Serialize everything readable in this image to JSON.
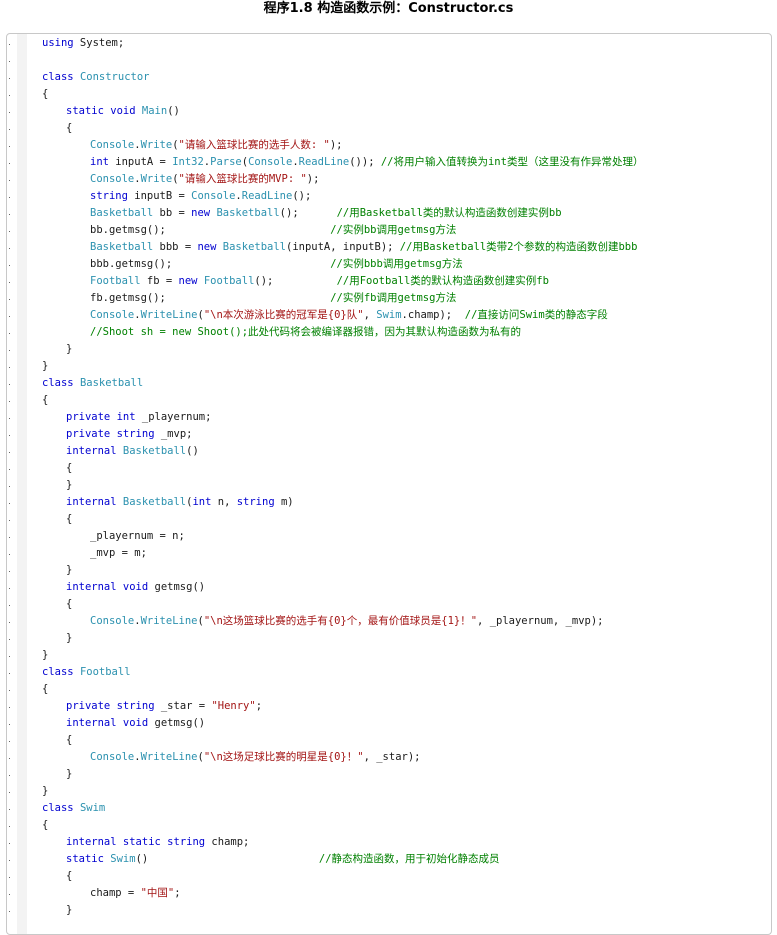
{
  "title": "程序1.8 构造函数示例：Constructor.cs",
  "colors": {
    "keyword": "#0000d0",
    "type": "#2b91af",
    "string": "#a31515",
    "comment": "#008000",
    "plain": "#1a1a1a"
  },
  "lines": [
    {
      "indent": 0,
      "tokens": [
        [
          "k",
          "using"
        ],
        [
          "p",
          " System;"
        ]
      ]
    },
    {
      "indent": 0,
      "tokens": []
    },
    {
      "indent": 0,
      "tokens": [
        [
          "k",
          "class"
        ],
        [
          "p",
          " "
        ],
        [
          "t",
          "Constructor"
        ]
      ]
    },
    {
      "indent": 0,
      "tokens": [
        [
          "p",
          "{"
        ]
      ]
    },
    {
      "indent": 1,
      "tokens": [
        [
          "k",
          "static"
        ],
        [
          "p",
          " "
        ],
        [
          "k",
          "void"
        ],
        [
          "p",
          " "
        ],
        [
          "t",
          "Main"
        ],
        [
          "p",
          "()"
        ]
      ]
    },
    {
      "indent": 1,
      "tokens": [
        [
          "p",
          "{"
        ]
      ]
    },
    {
      "indent": 2,
      "tokens": [
        [
          "t",
          "Console"
        ],
        [
          "p",
          "."
        ],
        [
          "t",
          "Write"
        ],
        [
          "p",
          "("
        ],
        [
          "s",
          "\"请输入篮球比赛的选手人数: \""
        ],
        [
          "p",
          ");"
        ]
      ]
    },
    {
      "indent": 2,
      "tokens": [
        [
          "k",
          "int"
        ],
        [
          "p",
          " inputA = "
        ],
        [
          "t",
          "Int32"
        ],
        [
          "p",
          "."
        ],
        [
          "t",
          "Parse"
        ],
        [
          "p",
          "("
        ],
        [
          "t",
          "Console"
        ],
        [
          "p",
          "."
        ],
        [
          "t",
          "ReadLine"
        ],
        [
          "p",
          "()); "
        ],
        [
          "c",
          "//将用户输入值转换为int类型（这里没有作异常处理）"
        ]
      ]
    },
    {
      "indent": 2,
      "tokens": [
        [
          "t",
          "Console"
        ],
        [
          "p",
          "."
        ],
        [
          "t",
          "Write"
        ],
        [
          "p",
          "("
        ],
        [
          "s",
          "\"请输入篮球比赛的MVP: \""
        ],
        [
          "p",
          ");"
        ]
      ]
    },
    {
      "indent": 2,
      "tokens": [
        [
          "k",
          "string"
        ],
        [
          "p",
          " inputB = "
        ],
        [
          "t",
          "Console"
        ],
        [
          "p",
          "."
        ],
        [
          "t",
          "ReadLine"
        ],
        [
          "p",
          "();"
        ]
      ]
    },
    {
      "indent": 2,
      "tokens": [
        [
          "t",
          "Basketball"
        ],
        [
          "p",
          " bb = "
        ],
        [
          "k",
          "new"
        ],
        [
          "p",
          " "
        ],
        [
          "t",
          "Basketball"
        ],
        [
          "p",
          "();      "
        ],
        [
          "c",
          "//用Basketball类的默认构造函数创建实例bb"
        ]
      ]
    },
    {
      "indent": 2,
      "tokens": [
        [
          "p",
          "bb.getmsg();                          "
        ],
        [
          "c",
          "//实例bb调用getmsg方法"
        ]
      ]
    },
    {
      "indent": 2,
      "tokens": [
        [
          "t",
          "Basketball"
        ],
        [
          "p",
          " bbb = "
        ],
        [
          "k",
          "new"
        ],
        [
          "p",
          " "
        ],
        [
          "t",
          "Basketball"
        ],
        [
          "p",
          "(inputA, inputB); "
        ],
        [
          "c",
          "//用Basketball类带2个参数的构造函数创建bbb"
        ]
      ]
    },
    {
      "indent": 2,
      "tokens": [
        [
          "p",
          "bbb.getmsg();                         "
        ],
        [
          "c",
          "//实例bbb调用getmsg方法"
        ]
      ]
    },
    {
      "indent": 2,
      "tokens": [
        [
          "t",
          "Football"
        ],
        [
          "p",
          " fb = "
        ],
        [
          "k",
          "new"
        ],
        [
          "p",
          " "
        ],
        [
          "t",
          "Football"
        ],
        [
          "p",
          "();          "
        ],
        [
          "c",
          "//用Football类的默认构造函数创建实例fb"
        ]
      ]
    },
    {
      "indent": 2,
      "tokens": [
        [
          "p",
          "fb.getmsg();                          "
        ],
        [
          "c",
          "//实例fb调用getmsg方法"
        ]
      ]
    },
    {
      "indent": 2,
      "tokens": [
        [
          "t",
          "Console"
        ],
        [
          "p",
          "."
        ],
        [
          "t",
          "WriteLine"
        ],
        [
          "p",
          "("
        ],
        [
          "s",
          "\"\\n本次游泳比赛的冠军是{0}队\""
        ],
        [
          "p",
          ", "
        ],
        [
          "t",
          "Swim"
        ],
        [
          "p",
          ".champ);  "
        ],
        [
          "c",
          "//直接访问Swim类的静态字段"
        ]
      ]
    },
    {
      "indent": 2,
      "tokens": [
        [
          "c",
          "//Shoot sh = new Shoot();此处代码将会被编译器报错，因为其默认构造函数为私有的"
        ]
      ]
    },
    {
      "indent": 1,
      "tokens": [
        [
          "p",
          "}"
        ]
      ]
    },
    {
      "indent": 0,
      "tokens": [
        [
          "p",
          "}"
        ]
      ]
    },
    {
      "indent": 0,
      "tokens": [
        [
          "k",
          "class"
        ],
        [
          "p",
          " "
        ],
        [
          "t",
          "Basketball"
        ]
      ]
    },
    {
      "indent": 0,
      "tokens": [
        [
          "p",
          "{"
        ]
      ]
    },
    {
      "indent": 1,
      "tokens": [
        [
          "k",
          "private"
        ],
        [
          "p",
          " "
        ],
        [
          "k",
          "int"
        ],
        [
          "p",
          " _playernum;"
        ]
      ]
    },
    {
      "indent": 1,
      "tokens": [
        [
          "k",
          "private"
        ],
        [
          "p",
          " "
        ],
        [
          "k",
          "string"
        ],
        [
          "p",
          " _mvp;"
        ]
      ]
    },
    {
      "indent": 1,
      "tokens": [
        [
          "k",
          "internal"
        ],
        [
          "p",
          " "
        ],
        [
          "t",
          "Basketball"
        ],
        [
          "p",
          "()"
        ]
      ]
    },
    {
      "indent": 1,
      "tokens": [
        [
          "p",
          "{"
        ]
      ]
    },
    {
      "indent": 1,
      "tokens": [
        [
          "p",
          "}"
        ]
      ]
    },
    {
      "indent": 1,
      "tokens": [
        [
          "k",
          "internal"
        ],
        [
          "p",
          " "
        ],
        [
          "t",
          "Basketball"
        ],
        [
          "p",
          "("
        ],
        [
          "k",
          "int"
        ],
        [
          "p",
          " n, "
        ],
        [
          "k",
          "string"
        ],
        [
          "p",
          " m)"
        ]
      ]
    },
    {
      "indent": 1,
      "tokens": [
        [
          "p",
          "{"
        ]
      ]
    },
    {
      "indent": 2,
      "tokens": [
        [
          "p",
          "_playernum = n;"
        ]
      ]
    },
    {
      "indent": 2,
      "tokens": [
        [
          "p",
          "_mvp = m;"
        ]
      ]
    },
    {
      "indent": 1,
      "tokens": [
        [
          "p",
          "}"
        ]
      ]
    },
    {
      "indent": 1,
      "tokens": [
        [
          "k",
          "internal"
        ],
        [
          "p",
          " "
        ],
        [
          "k",
          "void"
        ],
        [
          "p",
          " getmsg()"
        ]
      ]
    },
    {
      "indent": 1,
      "tokens": [
        [
          "p",
          "{"
        ]
      ]
    },
    {
      "indent": 2,
      "tokens": [
        [
          "t",
          "Console"
        ],
        [
          "p",
          "."
        ],
        [
          "t",
          "WriteLine"
        ],
        [
          "p",
          "("
        ],
        [
          "s",
          "\"\\n这场篮球比赛的选手有{0}个，最有价值球员是{1}！\""
        ],
        [
          "p",
          ", _playernum, _mvp);"
        ]
      ]
    },
    {
      "indent": 1,
      "tokens": [
        [
          "p",
          "}"
        ]
      ]
    },
    {
      "indent": 0,
      "tokens": [
        [
          "p",
          "}"
        ]
      ]
    },
    {
      "indent": 0,
      "tokens": [
        [
          "k",
          "class"
        ],
        [
          "p",
          " "
        ],
        [
          "t",
          "Football"
        ]
      ]
    },
    {
      "indent": 0,
      "tokens": [
        [
          "p",
          "{"
        ]
      ]
    },
    {
      "indent": 1,
      "tokens": [
        [
          "k",
          "private"
        ],
        [
          "p",
          " "
        ],
        [
          "k",
          "string"
        ],
        [
          "p",
          " _star = "
        ],
        [
          "s",
          "\"Henry\""
        ],
        [
          "p",
          ";"
        ]
      ]
    },
    {
      "indent": 1,
      "tokens": [
        [
          "k",
          "internal"
        ],
        [
          "p",
          " "
        ],
        [
          "k",
          "void"
        ],
        [
          "p",
          " getmsg()"
        ]
      ]
    },
    {
      "indent": 1,
      "tokens": [
        [
          "p",
          "{"
        ]
      ]
    },
    {
      "indent": 2,
      "tokens": [
        [
          "t",
          "Console"
        ],
        [
          "p",
          "."
        ],
        [
          "t",
          "WriteLine"
        ],
        [
          "p",
          "("
        ],
        [
          "s",
          "\"\\n这场足球比赛的明星是{0}！\""
        ],
        [
          "p",
          ", _star);"
        ]
      ]
    },
    {
      "indent": 1,
      "tokens": [
        [
          "p",
          "}"
        ]
      ]
    },
    {
      "indent": 0,
      "tokens": [
        [
          "p",
          "}"
        ]
      ]
    },
    {
      "indent": 0,
      "tokens": [
        [
          "k",
          "class"
        ],
        [
          "p",
          " "
        ],
        [
          "t",
          "Swim"
        ]
      ]
    },
    {
      "indent": 0,
      "tokens": [
        [
          "p",
          "{"
        ]
      ]
    },
    {
      "indent": 1,
      "tokens": [
        [
          "k",
          "internal"
        ],
        [
          "p",
          " "
        ],
        [
          "k",
          "static"
        ],
        [
          "p",
          " "
        ],
        [
          "k",
          "string"
        ],
        [
          "p",
          " champ;"
        ]
      ]
    },
    {
      "indent": 1,
      "tokens": [
        [
          "k",
          "static"
        ],
        [
          "p",
          " "
        ],
        [
          "t",
          "Swim"
        ],
        [
          "p",
          "()                           "
        ],
        [
          "c",
          "//静态构造函数，用于初始化静态成员"
        ]
      ]
    },
    {
      "indent": 1,
      "tokens": [
        [
          "p",
          "{"
        ]
      ]
    },
    {
      "indent": 2,
      "tokens": [
        [
          "p",
          "champ = "
        ],
        [
          "s",
          "\"中国\""
        ],
        [
          "p",
          ";"
        ]
      ]
    },
    {
      "indent": 1,
      "tokens": [
        [
          "p",
          "}"
        ]
      ]
    }
  ]
}
